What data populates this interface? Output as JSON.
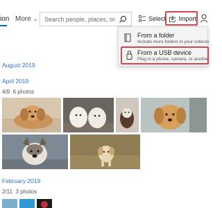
{
  "nav": {
    "partial_tab": "ion",
    "more_label": "More"
  },
  "search": {
    "placeholder": "Search people, places, or thing"
  },
  "toolbar": {
    "select_label": "Select",
    "import_label": "Import"
  },
  "import_menu": {
    "items": [
      {
        "title": "From a folder",
        "subtitle": "Include more folders in your collection",
        "icon": "folder-icon"
      },
      {
        "title": "From a USB device",
        "subtitle": "Plug in a phone, camera, or another",
        "icon": "usb-icon"
      }
    ]
  },
  "timeline": {
    "groups": [
      {
        "month": "August 2019"
      },
      {
        "month": "April 2019",
        "date": "4/9",
        "count": "6 photos"
      },
      {
        "month": "February 2019",
        "date": "2/11",
        "count": "3 photos"
      }
    ]
  },
  "colors": {
    "accent": "#0a63c9",
    "highlight": "#d9434a",
    "month_text": "#2a73c4"
  }
}
